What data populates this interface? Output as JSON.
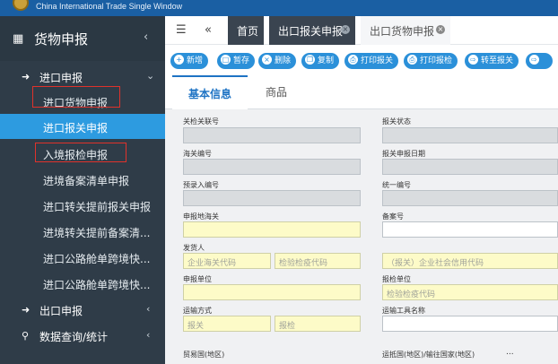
{
  "banner": {
    "brand": "China International Trade Single Window"
  },
  "sidebar": {
    "header": {
      "title": "货物申报",
      "icon": "cubes-icon"
    },
    "groups": [
      {
        "label": "进口申报",
        "icon": "sign-in-icon",
        "expanded": true
      },
      {
        "label": "出口申报",
        "icon": "sign-in-icon"
      },
      {
        "label": "数据查询/统计",
        "icon": "search-icon"
      }
    ],
    "items": [
      {
        "label": "进口货物申报"
      },
      {
        "label": "进口报关申报",
        "active": true
      },
      {
        "label": "入境报检申报"
      },
      {
        "label": "进境备案清单申报"
      },
      {
        "label": "进口转关提前报关申报"
      },
      {
        "label": "进境转关提前备案清..."
      },
      {
        "label": "进口公路舱单跨境快..."
      },
      {
        "label": "进口公路舱单跨境快..."
      }
    ]
  },
  "tabs": [
    {
      "label": "首页",
      "style": "dark"
    },
    {
      "label": "出口报关申报",
      "style": "dark",
      "closable": true
    },
    {
      "label": "出口货物申报",
      "style": "light",
      "closable": true
    }
  ],
  "toolbar": {
    "buttons": [
      {
        "label": "新增",
        "icon": "plus-icon"
      },
      {
        "label": "暂存",
        "icon": "save-icon"
      },
      {
        "label": "删除",
        "icon": "trash-icon"
      },
      {
        "label": "复制",
        "icon": "copy-icon"
      },
      {
        "label": "打印报关",
        "icon": "print-icon"
      },
      {
        "label": "打印报检",
        "icon": "print-icon"
      },
      {
        "label": "转至报关",
        "icon": "forward-icon"
      }
    ]
  },
  "content_tabs": [
    {
      "label": "基本信息",
      "active": true
    },
    {
      "label": "商品"
    }
  ],
  "form": {
    "fields": {
      "inspection_no": {
        "label": "关检关联号"
      },
      "declare_status": {
        "label": "报关状态"
      },
      "customs_no": {
        "label": "海关编号"
      },
      "declare_date": {
        "label": "报关申报日期"
      },
      "pre_entry_no": {
        "label": "预录入编号"
      },
      "unified_no": {
        "label": "统一编号"
      },
      "declare_customs": {
        "label": "申报地海关"
      },
      "record_no": {
        "label": "备案号"
      },
      "shipper": {
        "label": "发货人",
        "ph_customs_code": "企业海关代码",
        "ph_insp_code": "检验检疫代码",
        "ph_credit_code": "（报关）企业社会信用代码"
      },
      "declarant": {
        "label": "申报单位"
      },
      "insp_unit": {
        "label": "报检单位",
        "ph_insp_code": "检验检疫代码"
      },
      "transport_mode": {
        "label": "运输方式",
        "ph_customs": "报关",
        "ph_insp": "报检"
      },
      "transport_name": {
        "label": "运输工具名称"
      },
      "trade_country": {
        "label": "贸易国(地区)"
      },
      "dest_country": {
        "label": "运抵国(地区)/输往国家(地区)"
      }
    },
    "dots": "..."
  }
}
